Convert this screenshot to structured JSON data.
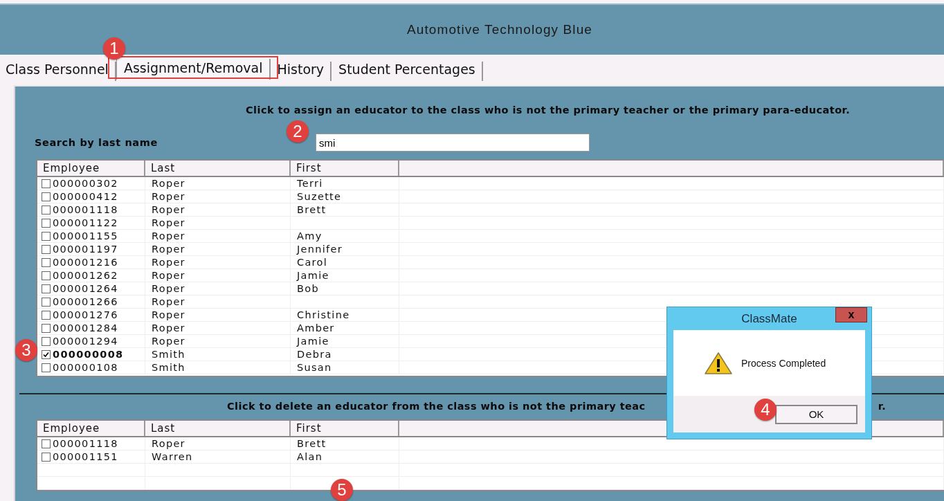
{
  "window": {
    "title": "Automotive Technology Blue"
  },
  "tabs": [
    {
      "label": "Class Personnel",
      "selected": false
    },
    {
      "label": "Assignment/Removal",
      "selected": true
    },
    {
      "label": "History",
      "selected": false
    },
    {
      "label": "Student Percentages",
      "selected": false
    }
  ],
  "assign_section": {
    "instruction": "Click to assign an educator to the class who is not the primary teacher or the primary para-educator.",
    "search_label": "Search by last name",
    "search": {
      "value": "smi"
    },
    "columns": [
      "Employee",
      "Last",
      "First"
    ],
    "rows": [
      {
        "employee": "000000302",
        "last": "Roper",
        "first": "Terri",
        "checked": false
      },
      {
        "employee": "000000412",
        "last": "Roper",
        "first": "Suzette",
        "checked": false
      },
      {
        "employee": "000001118",
        "last": "Roper",
        "first": "Brett",
        "checked": false
      },
      {
        "employee": "000001122",
        "last": "Roper",
        "checked": false
      },
      {
        "employee": "000001155",
        "last": "Roper",
        "first": "Amy",
        "checked": false
      },
      {
        "employee": "000001197",
        "last": "Roper",
        "first": "Jennifer",
        "checked": false
      },
      {
        "employee": "000001216",
        "last": "Roper",
        "first": "Carol",
        "checked": false
      },
      {
        "employee": "000001262",
        "last": "Roper",
        "first": "Jamie",
        "checked": false
      },
      {
        "employee": "000001264",
        "last": "Roper",
        "first": "Bob",
        "checked": false
      },
      {
        "employee": "000001266",
        "last": "Roper",
        "checked": false
      },
      {
        "employee": "000001276",
        "last": "Roper",
        "first": "Christine",
        "checked": false
      },
      {
        "employee": "000001284",
        "last": "Roper",
        "first": "Amber",
        "checked": false
      },
      {
        "employee": "000001294",
        "last": "Roper",
        "first": "Jamie",
        "checked": false
      },
      {
        "employee": "000000008",
        "last": "Smith",
        "first": "Debra",
        "checked": true
      },
      {
        "employee": "000000108",
        "last": "Smith",
        "first": "Susan",
        "checked": false
      }
    ]
  },
  "delete_section": {
    "instruction_start": "Click to delete an educator from the class who is not the primary teac",
    "instruction_end": "r.",
    "columns": [
      "Employee",
      "Last",
      "First"
    ],
    "rows": [
      {
        "employee": "000001118",
        "last": "Roper",
        "first": "Brett",
        "checked": false
      },
      {
        "employee": "000001151",
        "last": "Warren",
        "first": "Alan",
        "checked": false
      }
    ]
  },
  "dialog": {
    "title": "ClassMate",
    "close": "x",
    "message": "Process Completed",
    "button": "OK"
  },
  "annotations": [
    "1",
    "2",
    "3",
    "4",
    "5"
  ]
}
